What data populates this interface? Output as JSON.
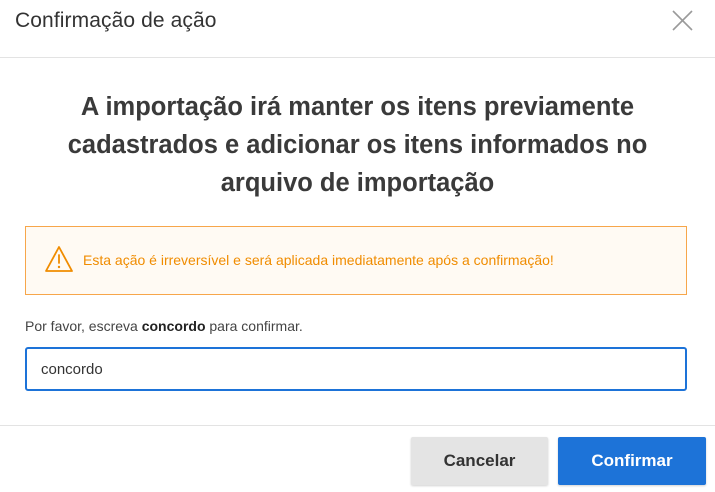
{
  "dialog": {
    "title": "Confirmação de ação",
    "close_icon": "close-icon"
  },
  "content": {
    "headline": "A importação irá manter os itens previamente cadastrados e adicionar os itens informados no arquivo de importação",
    "warning": {
      "icon": "warning-triangle-icon",
      "text": "Esta ação é irreversível e será aplicada imediatamente após a confirmação!",
      "color": "#f08c00"
    },
    "instruction": {
      "prefix": "Por favor, escreva ",
      "keyword": "concordo",
      "suffix": " para confirmar."
    },
    "input": {
      "value": "concordo"
    }
  },
  "footer": {
    "cancel_label": "Cancelar",
    "confirm_label": "Confirmar",
    "primary_color": "#1d73d8"
  }
}
